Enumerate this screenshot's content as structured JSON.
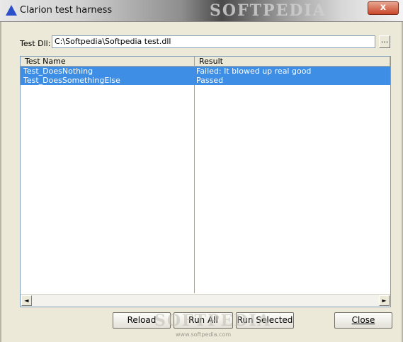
{
  "window": {
    "title": "Clarion test harness",
    "watermark": "SOFTPEDIA",
    "close_glyph": "x"
  },
  "dll": {
    "label": "Test Dll:",
    "value": "C:\\Softpedia\\Softpedia test.dll",
    "browse_label": "..."
  },
  "list": {
    "columns": [
      "Test Name",
      "Result"
    ],
    "rows": [
      {
        "name": "Test_DoesNothing",
        "result": "Failed: It blowed up real good"
      },
      {
        "name": "Test_DoesSomethingElse",
        "result": "Passed"
      }
    ],
    "scroll_left": "◄",
    "scroll_right": "►"
  },
  "buttons": {
    "reload": "Reload",
    "run_all": "Run All",
    "run_selected": "Run Selected",
    "close": "Close"
  },
  "footer_watermark_text": "SOFTPEDIA",
  "footer_url": "www.softpedia.com",
  "colors": {
    "selection": "#3d8ee4",
    "dialog_bg": "#ece9d8"
  }
}
